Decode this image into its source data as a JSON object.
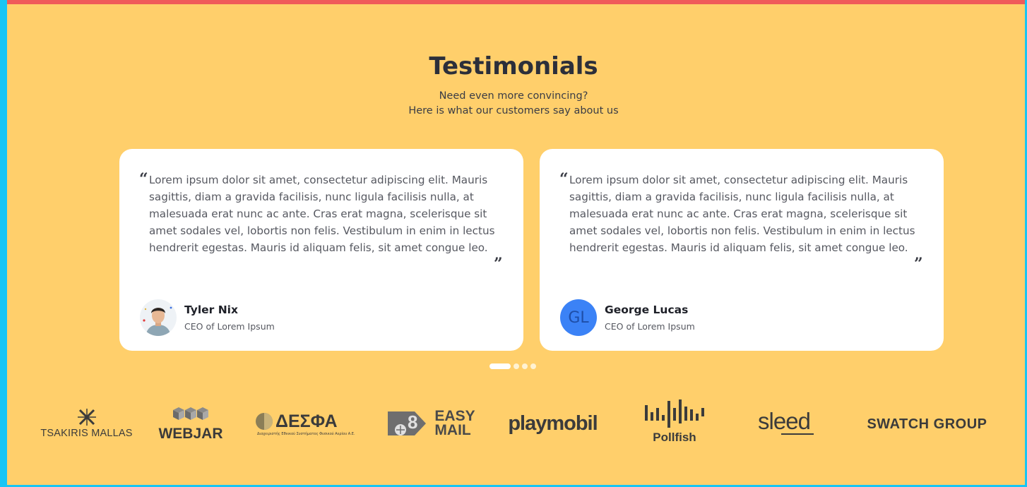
{
  "section": {
    "title": "Testimonials",
    "subtitle_line1": "Need even more convincing?",
    "subtitle_line2": "Here is what our customers say about us"
  },
  "testimonials": [
    {
      "quote": "Lorem ipsum dolor sit amet, consectetur adipiscing elit. Mauris sagittis, diam a gravida facilisis, nunc ligula facilisis nulla, at malesuada erat nunc ac ante. Cras erat magna, scelerisque sit amet sodales vel, lobortis non felis. Vestibulum in enim in lectus hendrerit egestas. Mauris id aliquam felis, sit amet congue leo.",
      "name": "Tyler Nix",
      "role": "CEO of Lorem Ipsum",
      "avatar": "photo"
    },
    {
      "quote": "Lorem ipsum dolor sit amet, consectetur adipiscing elit. Mauris sagittis, diam a gravida facilisis, nunc ligula facilisis nulla, at malesuada erat nunc ac ante. Cras erat magna, scelerisque sit amet sodales vel, lobortis non felis. Vestibulum in enim in lectus hendrerit egestas. Mauris id aliquam felis, sit amet congue leo.",
      "name": "George Lucas",
      "role": "CEO of Lorem Ipsum",
      "avatar_initials": "GL",
      "avatar_color": "#3b82f6"
    }
  ],
  "carousel": {
    "slides": 4,
    "active": 1
  },
  "logos": [
    {
      "name": "TSAKIRIS MALLAS"
    },
    {
      "name": "WEBJAR"
    },
    {
      "name": "ΔΕΣΦΑ",
      "tagline": "Διαχειριστής Εθνικού Συστήματος Φυσικού Αερίου Α.Ε."
    },
    {
      "name_top": "EASY",
      "name_bottom": "MAIL"
    },
    {
      "name": "playmobil"
    },
    {
      "name": "Pollfish"
    },
    {
      "name": "sleed"
    },
    {
      "name": "SWATCH GROUP"
    }
  ],
  "colors": {
    "background": "#ffcf6b",
    "top_bar": "#f05a5a",
    "frame": "#17c5f4",
    "card": "#ffffff"
  }
}
